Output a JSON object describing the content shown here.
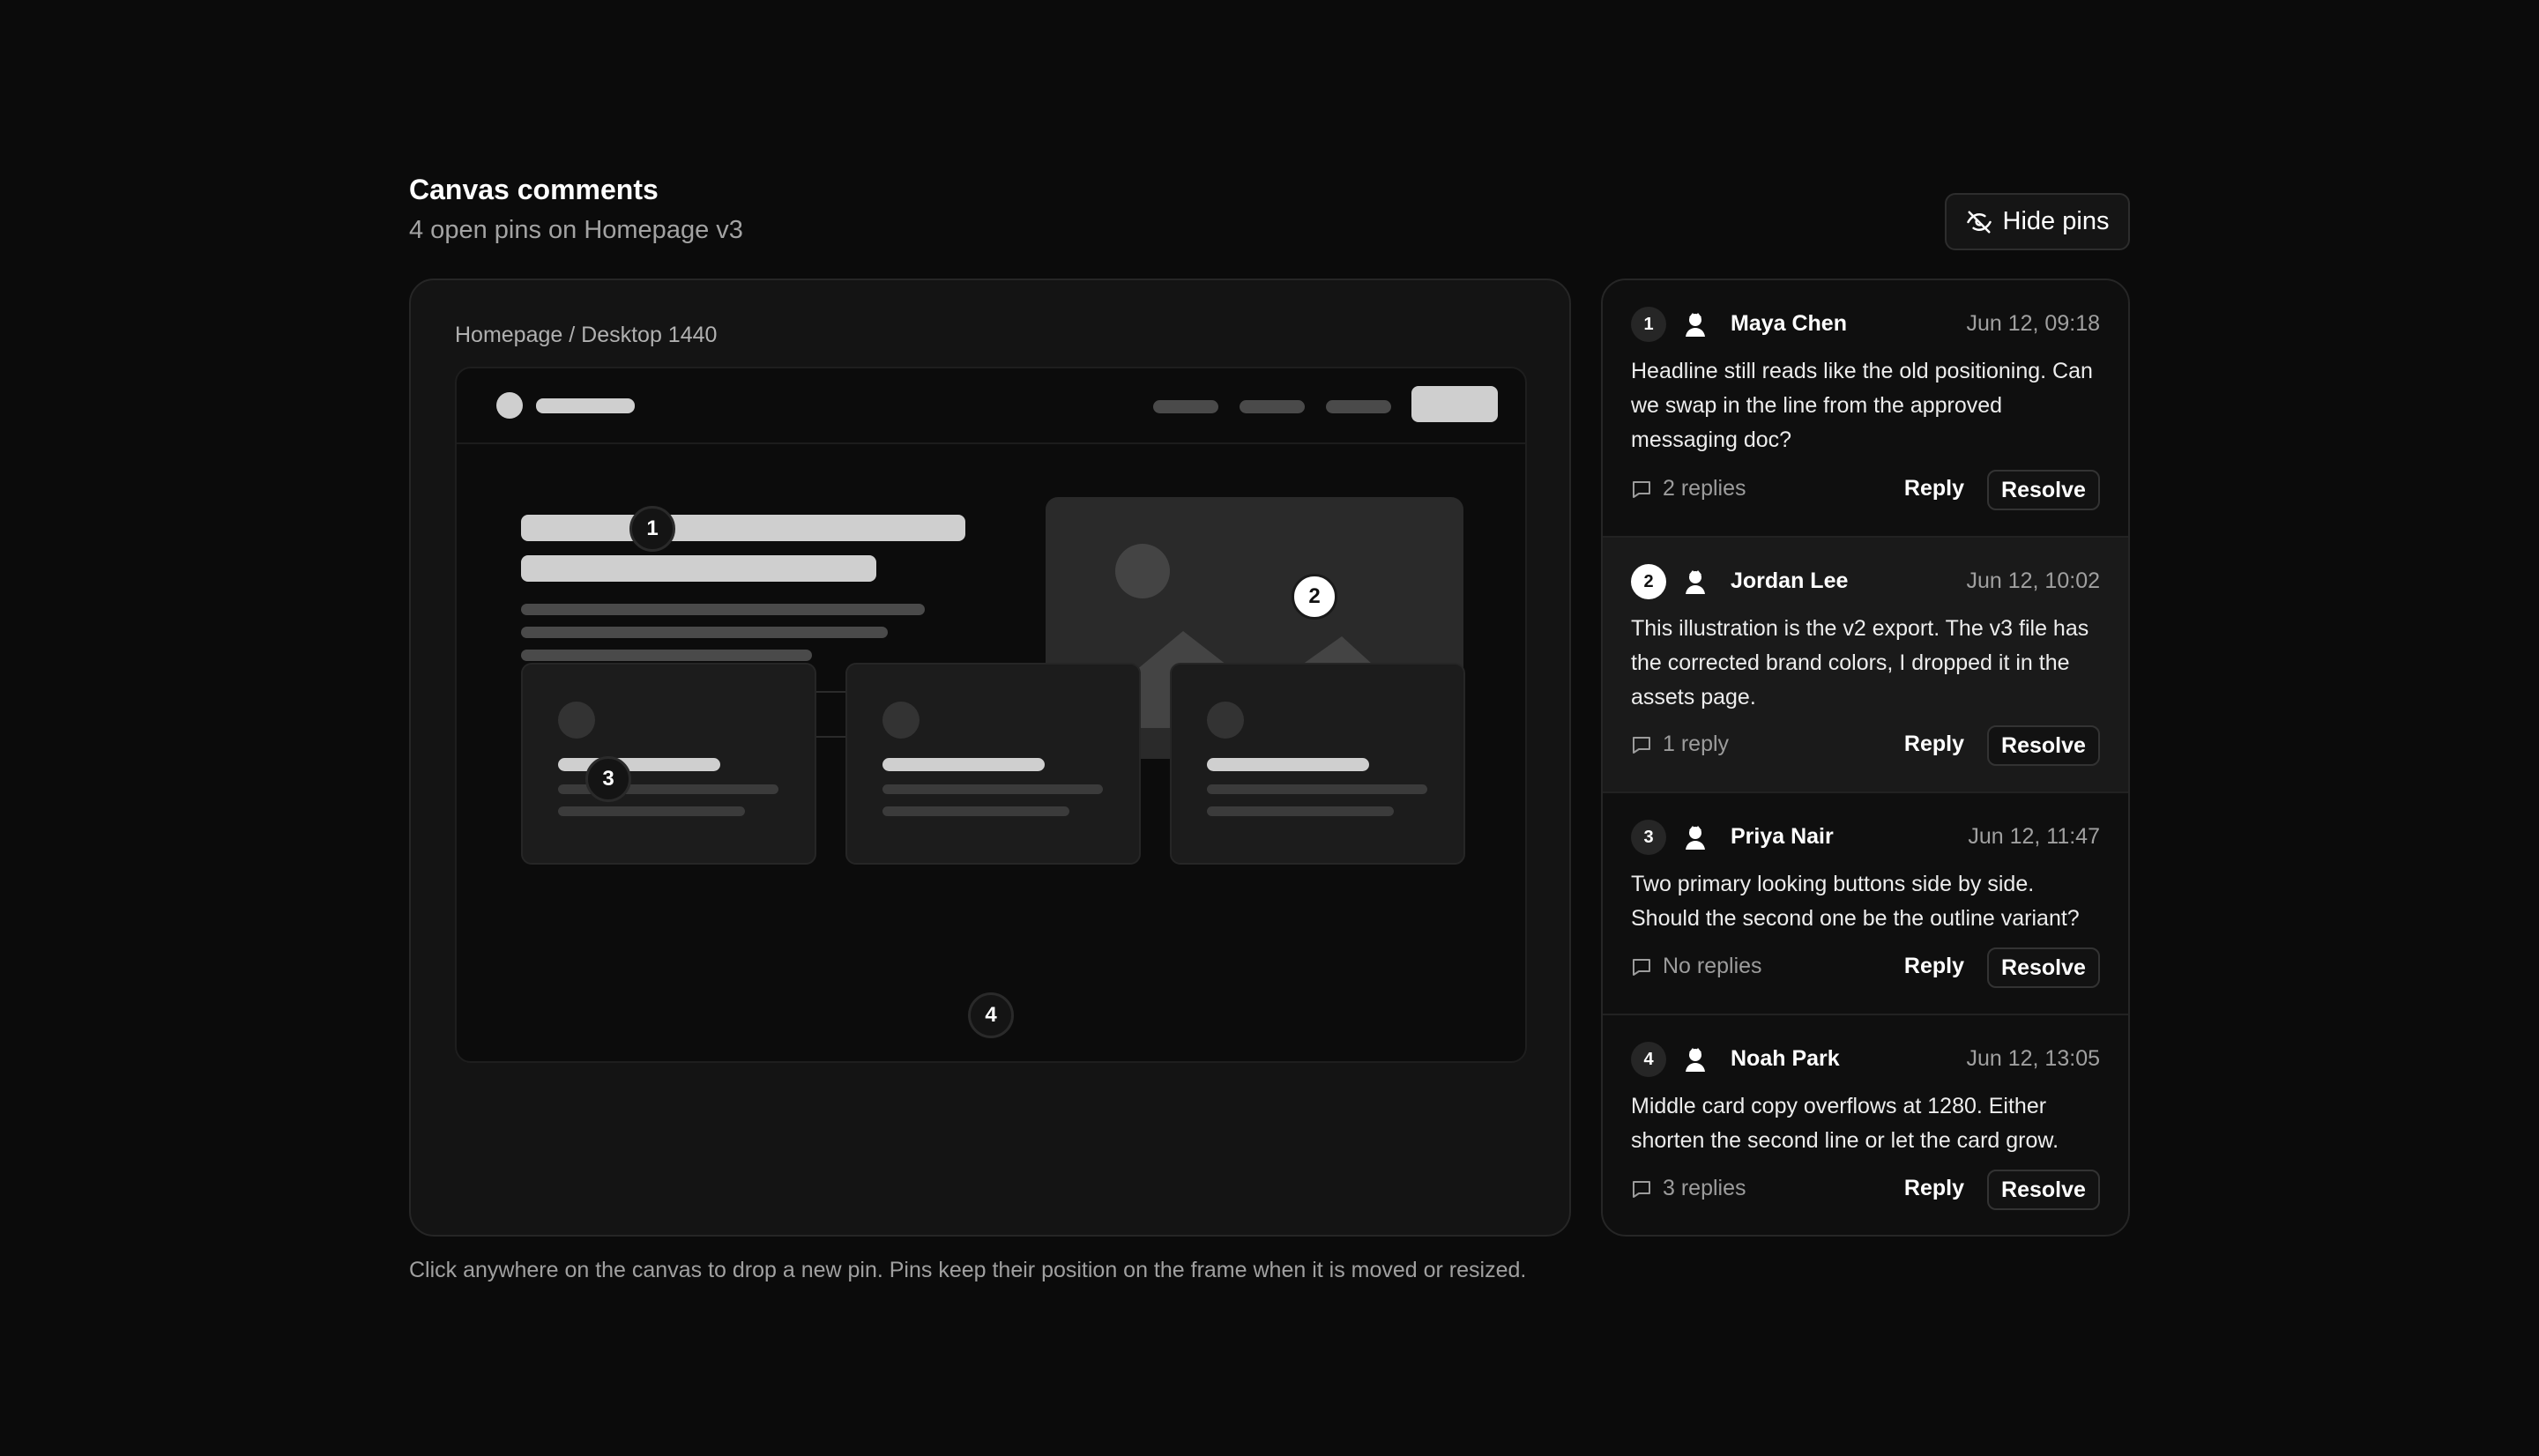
{
  "header": {
    "title": "Canvas comments",
    "subtitle": "4 open pins on Homepage v3",
    "hide_pins_label": "Hide pins"
  },
  "canvas": {
    "breadcrumb": "Homepage / Desktop 1440",
    "footnote": "Click anywhere on the canvas to drop a new pin. Pins keep their position on the frame when it is moved or resized."
  },
  "pins": [
    "1",
    "2",
    "3",
    "4"
  ],
  "comments": [
    {
      "num": "1",
      "author": "Maya Chen",
      "time": "Jun 12, 09:18",
      "body": "Headline still reads like the old positioning. Can we swap in the line from the approved messaging doc?",
      "replies": "2 replies",
      "reply_label": "Reply",
      "resolve_label": "Resolve"
    },
    {
      "num": "2",
      "author": "Jordan Lee",
      "time": "Jun 12, 10:02",
      "body": "This illustration is the v2 export. The v3 file has the corrected brand colors, I dropped it in the assets page.",
      "replies": "1 reply",
      "reply_label": "Reply",
      "resolve_label": "Resolve"
    },
    {
      "num": "3",
      "author": "Priya Nair",
      "time": "Jun 12, 11:47",
      "body": "Two primary looking buttons side by side. Should the second one be the outline variant?",
      "replies": "No replies",
      "reply_label": "Reply",
      "resolve_label": "Resolve"
    },
    {
      "num": "4",
      "author": "Noah Park",
      "time": "Jun 12, 13:05",
      "body": "Middle card copy overflows at 1280. Either shorten the second line or let the card grow.",
      "replies": "3 replies",
      "reply_label": "Reply",
      "resolve_label": "Resolve"
    }
  ],
  "icons": {
    "hide_pins": "eye-off-icon",
    "replies": "speech-bubble-icon",
    "avatar": "avatar-icon",
    "image_placeholder": "image-placeholder-icon"
  },
  "colors": {
    "background": "#0b0b0b",
    "panel": "#141414",
    "active_pin": "#ffffff",
    "muted_text": "#a3a3a3"
  },
  "active_comment": "2"
}
